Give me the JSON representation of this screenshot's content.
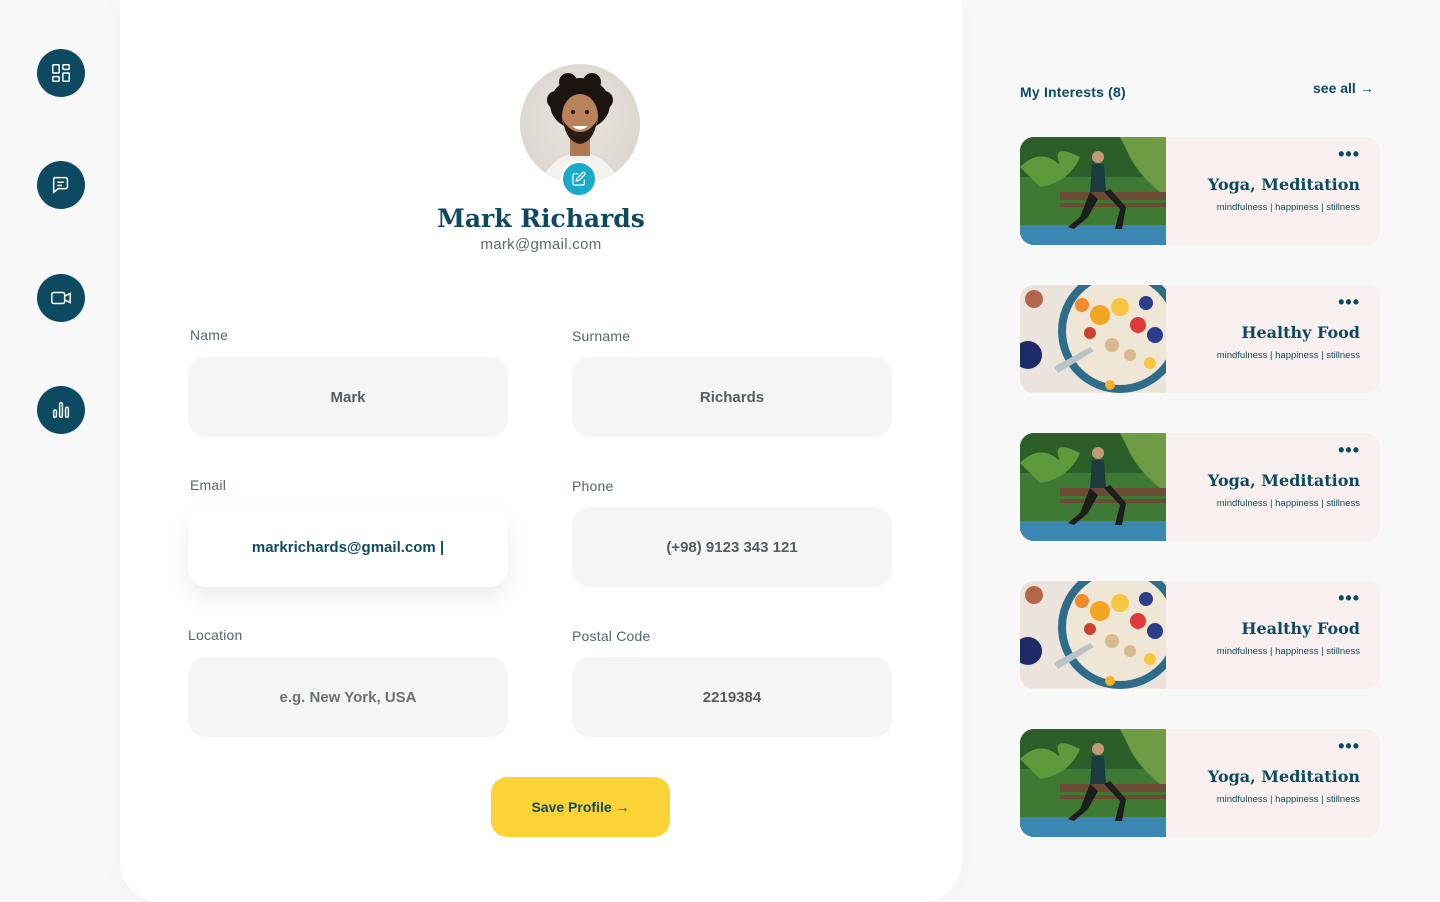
{
  "nav": {
    "items": [
      {
        "name": "dashboard-icon"
      },
      {
        "name": "chat-icon"
      },
      {
        "name": "video-icon"
      },
      {
        "name": "stats-icon"
      }
    ]
  },
  "profile": {
    "name": "Mark Richards",
    "email": "mark@gmail.com"
  },
  "form": {
    "name_label": "Name",
    "name_value": "Mark",
    "surname_label": "Surname",
    "surname_value": "Richards",
    "email_label": "Email",
    "email_value": "markrichards@gmail.com |",
    "phone_label": "Phone",
    "phone_value": "(+98) 9123 343 121",
    "location_label": "Location",
    "location_placeholder": "e.g. New York, USA",
    "postal_label": "Postal Code",
    "postal_value": "2219384",
    "save_label": "Save Profile →"
  },
  "interests": {
    "title": "My Interests (8)",
    "see_all": "see all →",
    "items": [
      {
        "title": "Yoga, Meditation",
        "tags": "mindfulness | happiness | stillness",
        "image": "yoga"
      },
      {
        "title": "Healthy Food",
        "tags": "mindfulness | happiness | stillness",
        "image": "food"
      },
      {
        "title": "Yoga, Meditation",
        "tags": "mindfulness | happiness | stillness",
        "image": "yoga"
      },
      {
        "title": "Healthy Food",
        "tags": "mindfulness | happiness | stillness",
        "image": "food"
      },
      {
        "title": "Yoga, Meditation",
        "tags": "mindfulness | happiness | stillness",
        "image": "yoga"
      }
    ]
  },
  "colors": {
    "primary": "#0d4a61",
    "accent": "#fbd336",
    "edit_badge": "#1aa9c9",
    "card_bg": "#f8f0ef"
  }
}
